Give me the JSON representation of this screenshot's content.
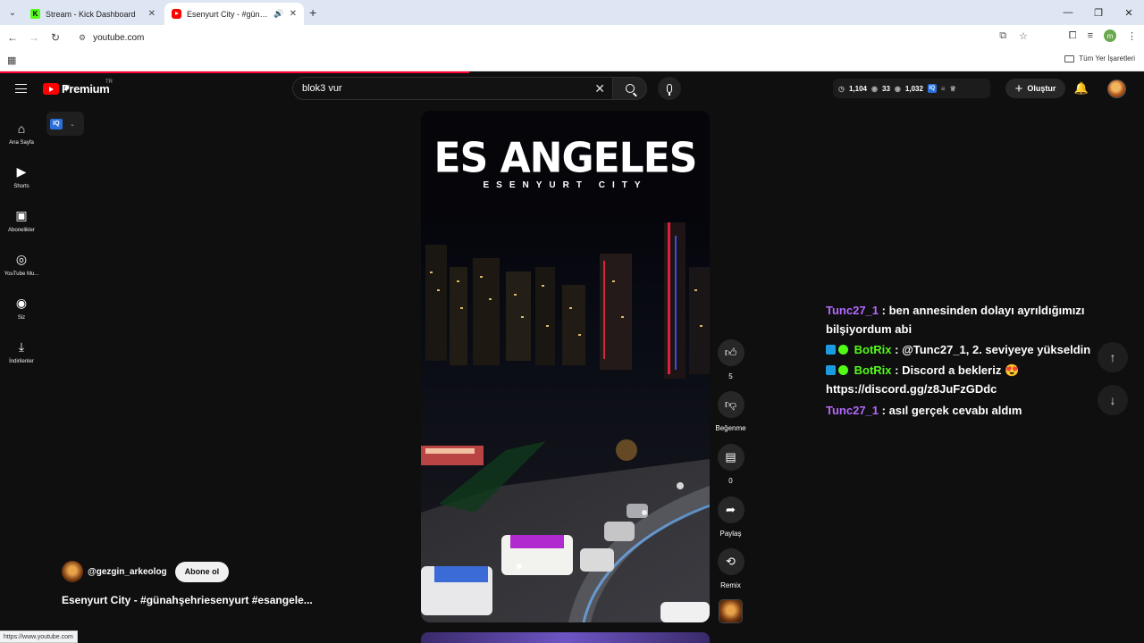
{
  "browser": {
    "tabs": [
      {
        "title": "Stream - Kick Dashboard",
        "favicon": "kick-icon",
        "favicon_text": "K"
      },
      {
        "title": "Esenyurt City - #günahşehri",
        "favicon": "youtube-icon",
        "active": true
      }
    ],
    "url": "youtube.com",
    "bookmarks_all": "Tüm Yer İşaretleri",
    "profile_initial": "m"
  },
  "youtube": {
    "logo_text": "Premium",
    "country_code": "TR",
    "search": {
      "query": "blok3 vur"
    },
    "header_stats": {
      "watching": "1,104",
      "likes": "33",
      "views": "1,032",
      "iq_text": "IQ"
    },
    "create_label": "Oluştur",
    "guide": [
      {
        "label": "Ana Sayfa",
        "icon": "home-icon",
        "glyph": "⌂"
      },
      {
        "label": "Shorts",
        "icon": "shorts-icon",
        "glyph": "▶"
      },
      {
        "label": "Abonelikler",
        "icon": "subscriptions-icon",
        "glyph": "▣"
      },
      {
        "label": "YouTube Mu...",
        "icon": "youtube-music-icon",
        "glyph": "◎"
      },
      {
        "label": "Siz",
        "icon": "you-icon",
        "glyph": "◉"
      },
      {
        "label": "İndirilenler",
        "icon": "downloads-icon",
        "glyph": "⤓"
      }
    ],
    "iq_chip": "IQ",
    "video": {
      "overlay_title": "ES ANGELES",
      "overlay_subtitle": "ESENYURT CITY",
      "channel": "@gezgin_arkeolog",
      "subscribe_label": "Abone ol",
      "caption": "Esenyurt City - #günahşehriesenyurt #esangele..."
    },
    "actions": {
      "like_count": "5",
      "dislike_label": "Beğenme",
      "comment_count": "0",
      "share_label": "Paylaş",
      "remix_label": "Remix"
    }
  },
  "chat": {
    "messages": [
      {
        "user": "Tunc27_1",
        "text": " : ben annesinden dolayı ayrıldığımızı",
        "text_cont": "bilşiyordum abi"
      },
      {
        "user": "BotRix",
        "text": " : @Tunc27_1, 2. seviyeye yükseldin"
      },
      {
        "user": "BotRix",
        "text": " : Discord a bekleriz 😍",
        "text_cont": "https://discord.gg/z8JuFzGDdc"
      },
      {
        "user": "Tunc27_1",
        "text": " : asıl gerçek cevabı aldım"
      }
    ],
    "colors": {
      "user": "#b469ff",
      "bot": "#53fc18"
    }
  },
  "status_bar": "https://www.youtube.com"
}
